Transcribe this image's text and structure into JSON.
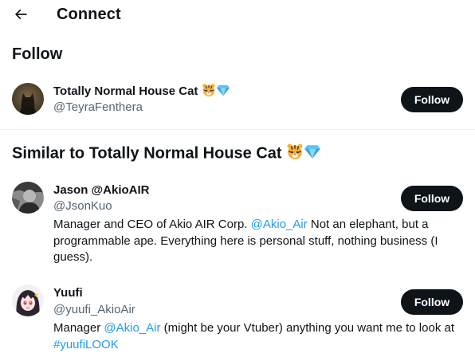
{
  "header": {
    "title": "Connect",
    "back_icon": "arrow-left-icon"
  },
  "follow_section": {
    "title": "Follow",
    "user": {
      "name": "Totally Normal House Cat",
      "handle": "@TeyraFenthera",
      "badges": [
        "tiger-face-emoji",
        "gem-emoji"
      ],
      "button_label": "Follow"
    }
  },
  "similar_section": {
    "title": "Similar to Totally Normal House Cat",
    "badges": [
      "tiger-face-emoji",
      "gem-emoji"
    ],
    "users": [
      {
        "name": "Jason @AkioAIR",
        "handle": "@JsonKuo",
        "bio_line1_pre": "Manager and CEO of Akio AIR Corp. ",
        "bio_line1_link": "@Akio_Air",
        "bio_line1_post": " Not an elephant, but a",
        "bio_line2": "programmable ape. Everything here is personal stuff, nothing business (I",
        "bio_line3": "guess).",
        "button_label": "Follow"
      },
      {
        "name": "Yuufi",
        "handle": "@yuufi_AkioAir",
        "bio_line1_pre": "Manager ",
        "bio_line1_link": "@Akio_Air",
        "bio_line1_post": " (might be your Vtuber) anything you want me to look at",
        "bio_line2_link": "#yuufiLOOK",
        "button_label": "Follow"
      }
    ]
  },
  "colors": {
    "text": "#0f1419",
    "secondary": "#536471",
    "link": "#1d9bf0",
    "button": "#0f1419",
    "divider": "#eff3f4"
  }
}
